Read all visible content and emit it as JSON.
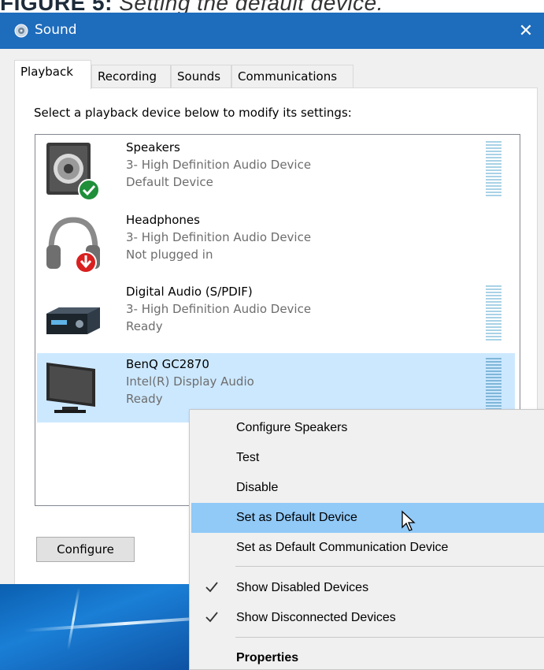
{
  "caption": {
    "bold": "FIGURE 5:",
    "rest": " Setting the default device."
  },
  "window": {
    "title": "Sound",
    "close_glyph": "✕"
  },
  "tabs": [
    {
      "label": "Playback"
    },
    {
      "label": "Recording"
    },
    {
      "label": "Sounds"
    },
    {
      "label": "Communications"
    }
  ],
  "instruction": "Select a playback device below to modify its settings:",
  "devices": [
    {
      "name": "Speakers",
      "driver": "3- High Definition Audio Device",
      "status": "Default Device",
      "icon": "speaker-icon",
      "badge": "default-check-badge"
    },
    {
      "name": "Headphones",
      "driver": "3- High Definition Audio Device",
      "status": "Not plugged in",
      "icon": "headphones-icon",
      "badge": "unplugged-arrow-badge"
    },
    {
      "name": "Digital Audio (S/PDIF)",
      "driver": "3- High Definition Audio Device",
      "status": "Ready",
      "icon": "receiver-icon"
    },
    {
      "name": "BenQ GC2870",
      "driver": "Intel(R) Display Audio",
      "status": "Ready",
      "icon": "monitor-icon",
      "selected": true
    }
  ],
  "buttons": {
    "configure": "Configure"
  },
  "context_menu": {
    "items": [
      {
        "label": "Configure Speakers"
      },
      {
        "label": "Test"
      },
      {
        "label": "Disable"
      },
      {
        "label": "Set as Default Device",
        "highlighted": true
      },
      {
        "label": "Set as Default Communication Device"
      },
      {
        "label": "Show Disabled Devices",
        "checked": true
      },
      {
        "label": "Show Disconnected Devices",
        "checked": true
      },
      {
        "label": "Properties",
        "bold": true
      }
    ]
  },
  "colors": {
    "titlebar": "#1e6cbc",
    "selection": "#cce8ff",
    "menu_highlight": "#91c9f7",
    "default_badge": "#1f8f3a",
    "unplugged_badge": "#d91f1f"
  }
}
